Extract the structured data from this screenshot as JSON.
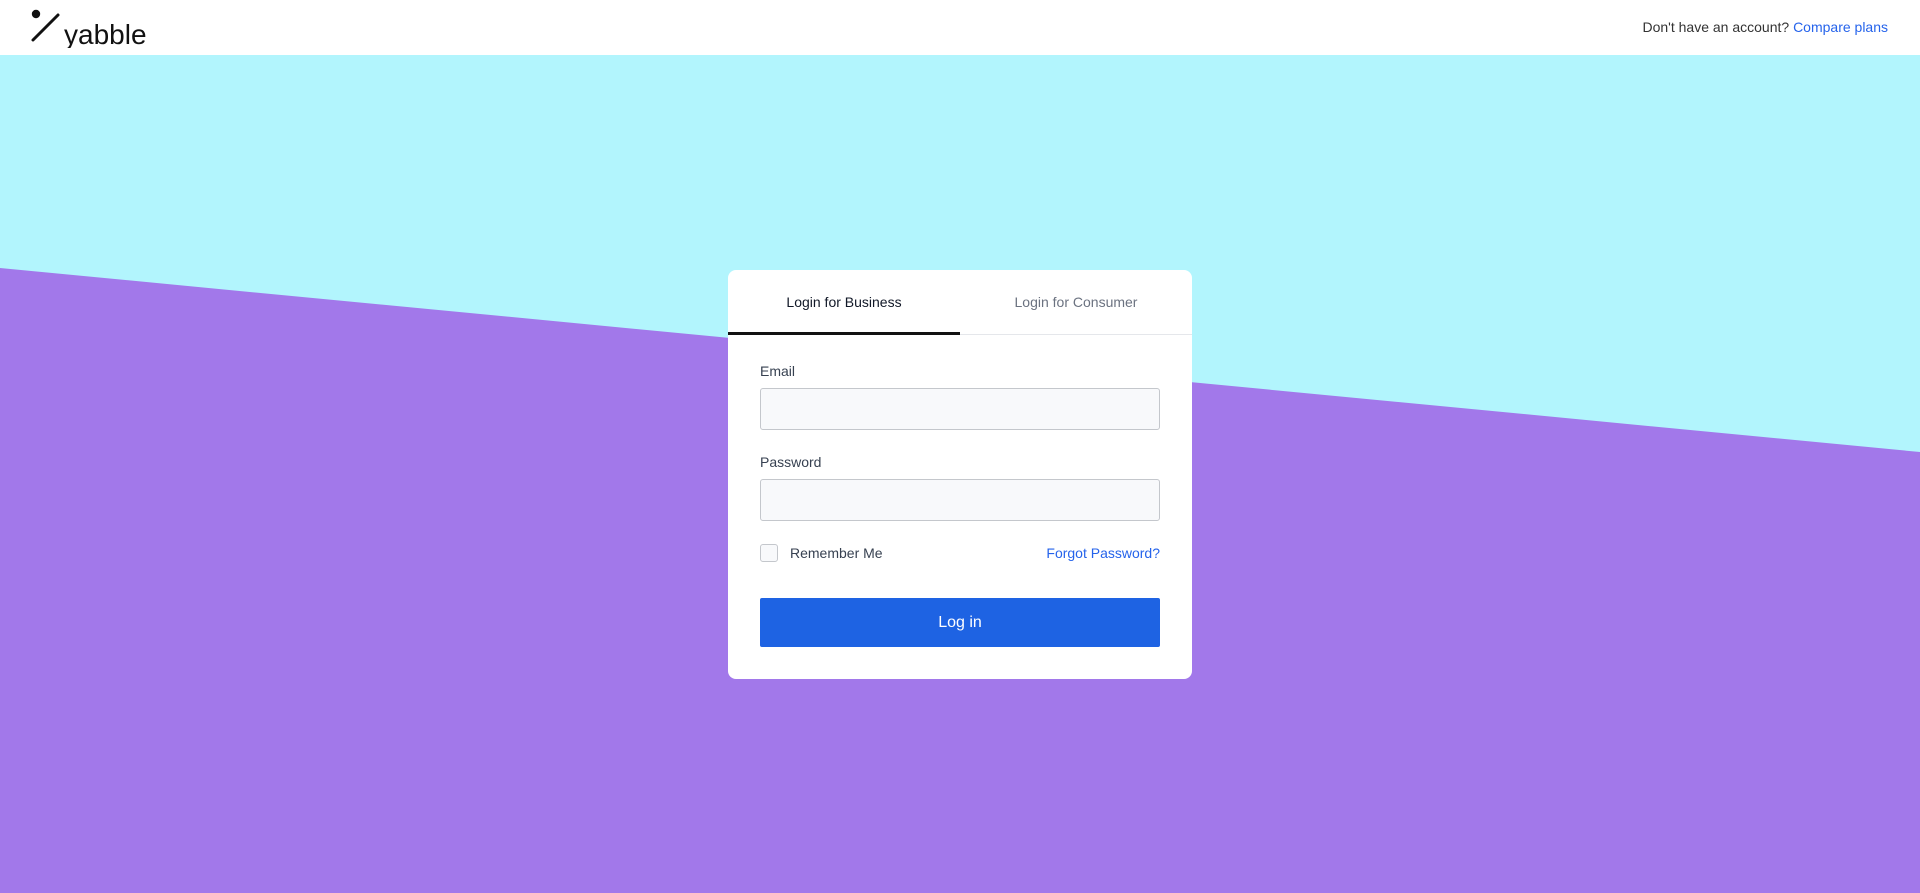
{
  "brand": {
    "name": "yabble"
  },
  "header": {
    "account_prompt": "Don't have an account?",
    "compare_link": "Compare plans"
  },
  "colors": {
    "bg_top": "#b2f5fd",
    "bg_bottom": "#a278ea",
    "primary": "#1e63e3",
    "link": "#2563eb"
  },
  "tabs": [
    {
      "label": "Login for Business",
      "active": true
    },
    {
      "label": "Login for Consumer",
      "active": false
    }
  ],
  "form": {
    "email_label": "Email",
    "email_value": "",
    "password_label": "Password",
    "password_value": "",
    "remember_label": "Remember Me",
    "remember_checked": false,
    "forgot_link": "Forgot Password?",
    "submit_label": "Log in"
  }
}
